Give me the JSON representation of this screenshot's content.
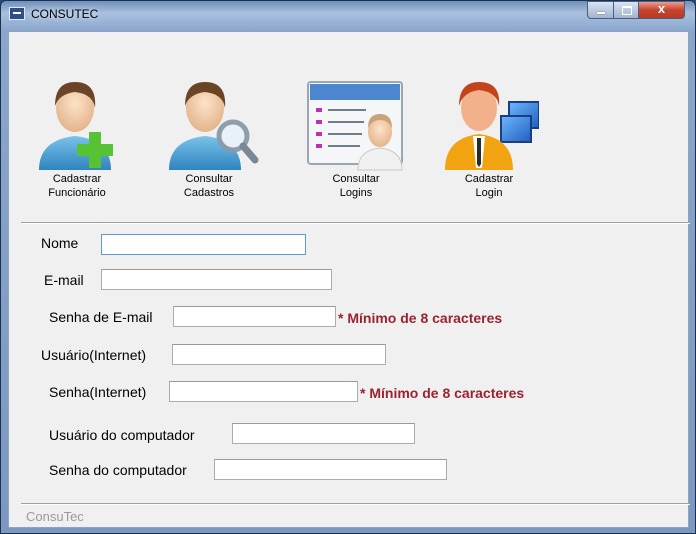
{
  "window": {
    "title": "CONSUTEC",
    "close_glyph": "x"
  },
  "toolbar": [
    {
      "label": "Cadastrar\nFuncionário",
      "icon": "person-add-icon"
    },
    {
      "label": "Consultar\nCadastros",
      "icon": "person-search-icon"
    },
    {
      "label": "Consultar\nLogins",
      "icon": "login-list-icon"
    },
    {
      "label": "Cadastrar\nLogin",
      "icon": "network-user-icon"
    }
  ],
  "form": {
    "nome": {
      "label": "Nome",
      "value": ""
    },
    "email": {
      "label": "E-mail",
      "value": ""
    },
    "senha_email": {
      "label": "Senha de E-mail",
      "value": "",
      "note": "* Mínimo de 8 caracteres"
    },
    "usuario_internet": {
      "label": "Usuário(Internet)",
      "value": ""
    },
    "senha_internet": {
      "label": "Senha(Internet)",
      "value": "",
      "note": "* Mínimo de 8 caracteres"
    },
    "usuario_computador": {
      "label": "Usuário do computador",
      "value": ""
    },
    "senha_computador": {
      "label": "Senha do computador",
      "value": ""
    }
  },
  "status": {
    "text": "ConsuTec"
  },
  "colors": {
    "note": "#9b2330",
    "accent": "#5b9bd5"
  }
}
